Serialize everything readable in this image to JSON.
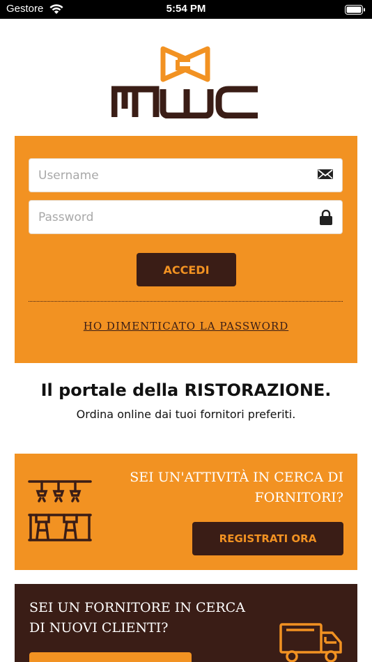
{
  "status_bar": {
    "carrier": "Gestore",
    "time": "5:54 PM"
  },
  "logo": {
    "text": "MWC"
  },
  "login": {
    "username_placeholder": "Username",
    "password_placeholder": "Password",
    "submit_label": "ACCEDI",
    "forgot_label": "HO DIMENTICATO LA PASSWORD"
  },
  "intro": {
    "title": "Il portale della RISTORAZIONE.",
    "subtitle": "Ordina online dai tuoi fornitori preferiti."
  },
  "business": {
    "question_line1": "SEI UN'ATTIVITÀ IN CERCA DI",
    "question_line2": "FORNITORI?",
    "register_label": "REGISTRATI ORA"
  },
  "supplier": {
    "question_line1": "SEI UN FORNITORE IN CERCA",
    "question_line2": "DI NUOVI CLIENTI?"
  },
  "colors": {
    "accent": "#f29222",
    "dark": "#3a1d16"
  }
}
